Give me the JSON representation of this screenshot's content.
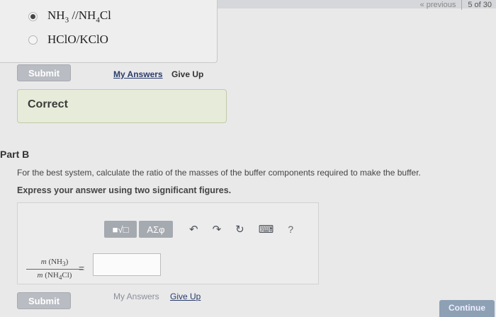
{
  "pager": {
    "previous_label": "« previous",
    "position": "5 of 30"
  },
  "part_a": {
    "choices": [
      {
        "main1": "NH",
        "sub1": "3",
        "slash": " /",
        "main2": "NH",
        "sub2": "4",
        "tail": "Cl",
        "selected": true
      },
      {
        "label": "HClO/KClO",
        "selected": false
      }
    ],
    "submit_label": "Submit",
    "my_answers_label": "My Answers",
    "give_up_label": "Give Up",
    "feedback": "Correct"
  },
  "part_b": {
    "title": "Part B",
    "question": "For the best system, calculate the ratio of the masses of the buffer components required to make the buffer.",
    "instructions": "Express your answer using two significant figures.",
    "toolbar": {
      "template_label": "■√□",
      "symbols_label": "ΑΣφ",
      "undo_glyph": "↶",
      "redo_glyph": "↷",
      "reset_glyph": "↻",
      "keyboard_glyph": "⌨",
      "help_glyph": "?"
    },
    "numerator": {
      "m": "m",
      "open": " (NH",
      "sub": "3",
      "close": ")"
    },
    "denominator": {
      "m": "m",
      "open": " (NH",
      "sub": "4",
      "close": "Cl)"
    },
    "equals": "=",
    "answer_value": "",
    "submit_label": "Submit",
    "my_answers_label": "My Answers",
    "give_up_label": "Give Up"
  },
  "continue_label": "Continue"
}
